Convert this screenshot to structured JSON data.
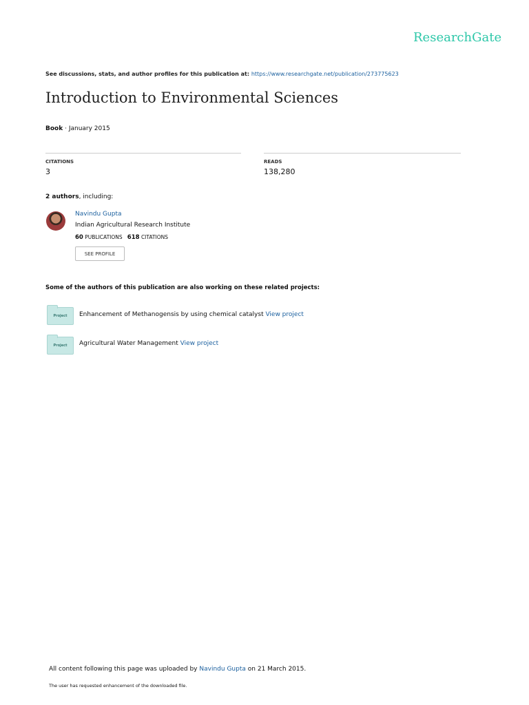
{
  "brand": "ResearchGate",
  "discussion": {
    "text": "See discussions, stats, and author profiles for this publication at:",
    "url": "https://www.researchgate.net/publication/273775623"
  },
  "title": "Introduction to Environmental Sciences",
  "meta": {
    "type": "Book",
    "date": "· January 2015"
  },
  "citations": {
    "label": "CITATIONS",
    "value": "3"
  },
  "reads": {
    "label": "READS",
    "value": "138,280"
  },
  "authors": {
    "count": "2 authors",
    "suffix": ", including:"
  },
  "author": {
    "name": "Navindu Gupta",
    "institution": "Indian Agricultural Research Institute",
    "publications": "60",
    "publications_label": "PUBLICATIONS",
    "citations": "618",
    "citations_label": "CITATIONS",
    "see_profile": "SEE PROFILE"
  },
  "related_heading": "Some of the authors of this publication are also working on these related projects:",
  "projects": [
    {
      "badge": "Project",
      "title": "Enhancement of Methanogensis by using chemical catalyst",
      "link": "View project"
    },
    {
      "badge": "Project",
      "title": "Agricultural Water Management",
      "link": "View project"
    }
  ],
  "footer": {
    "prefix": "All content following this page was uploaded by",
    "uploader": "Navindu Gupta",
    "suffix": "on 21 March 2015.",
    "note": "The user has requested enhancement of the downloaded file."
  }
}
